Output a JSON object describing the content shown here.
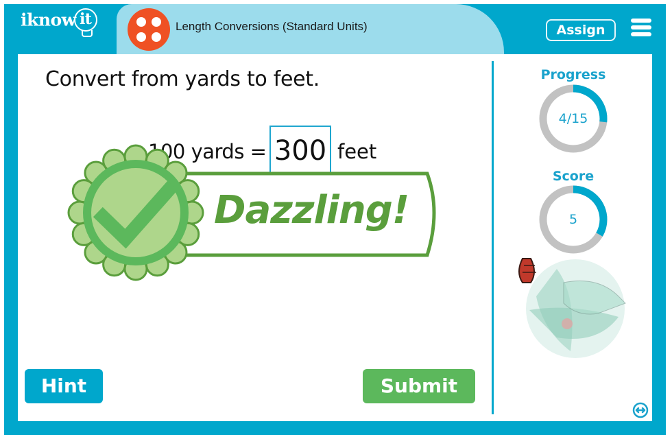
{
  "header": {
    "logo_text": "iknow",
    "logo_tail": "it",
    "lesson_title": "Length Conversions (Standard Units)",
    "assign_label": "Assign",
    "menu_icon": "hamburger-menu-icon",
    "badge_icon": "four-dots-icon"
  },
  "question": {
    "prompt": "Convert from yards to feet.",
    "left_side": "100 yards =",
    "answer_value": "300",
    "unit": "feet"
  },
  "feedback": {
    "message": "Dazzling!",
    "icon": "checkmark-seal-icon"
  },
  "sidebar": {
    "progress_label": "Progress",
    "progress_text": "4/15",
    "progress_fraction": 0.267,
    "score_label": "Score",
    "score_text": "5",
    "score_fraction": 0.333
  },
  "buttons": {
    "hint": "Hint",
    "submit": "Submit"
  },
  "colors": {
    "frame": "#00a7cc",
    "title_pill": "#9cdcec",
    "badge": "#ef5124",
    "success": "#5cb85c",
    "banner_green": "#5a9e3c",
    "ring_gray": "#c2c2c2"
  }
}
